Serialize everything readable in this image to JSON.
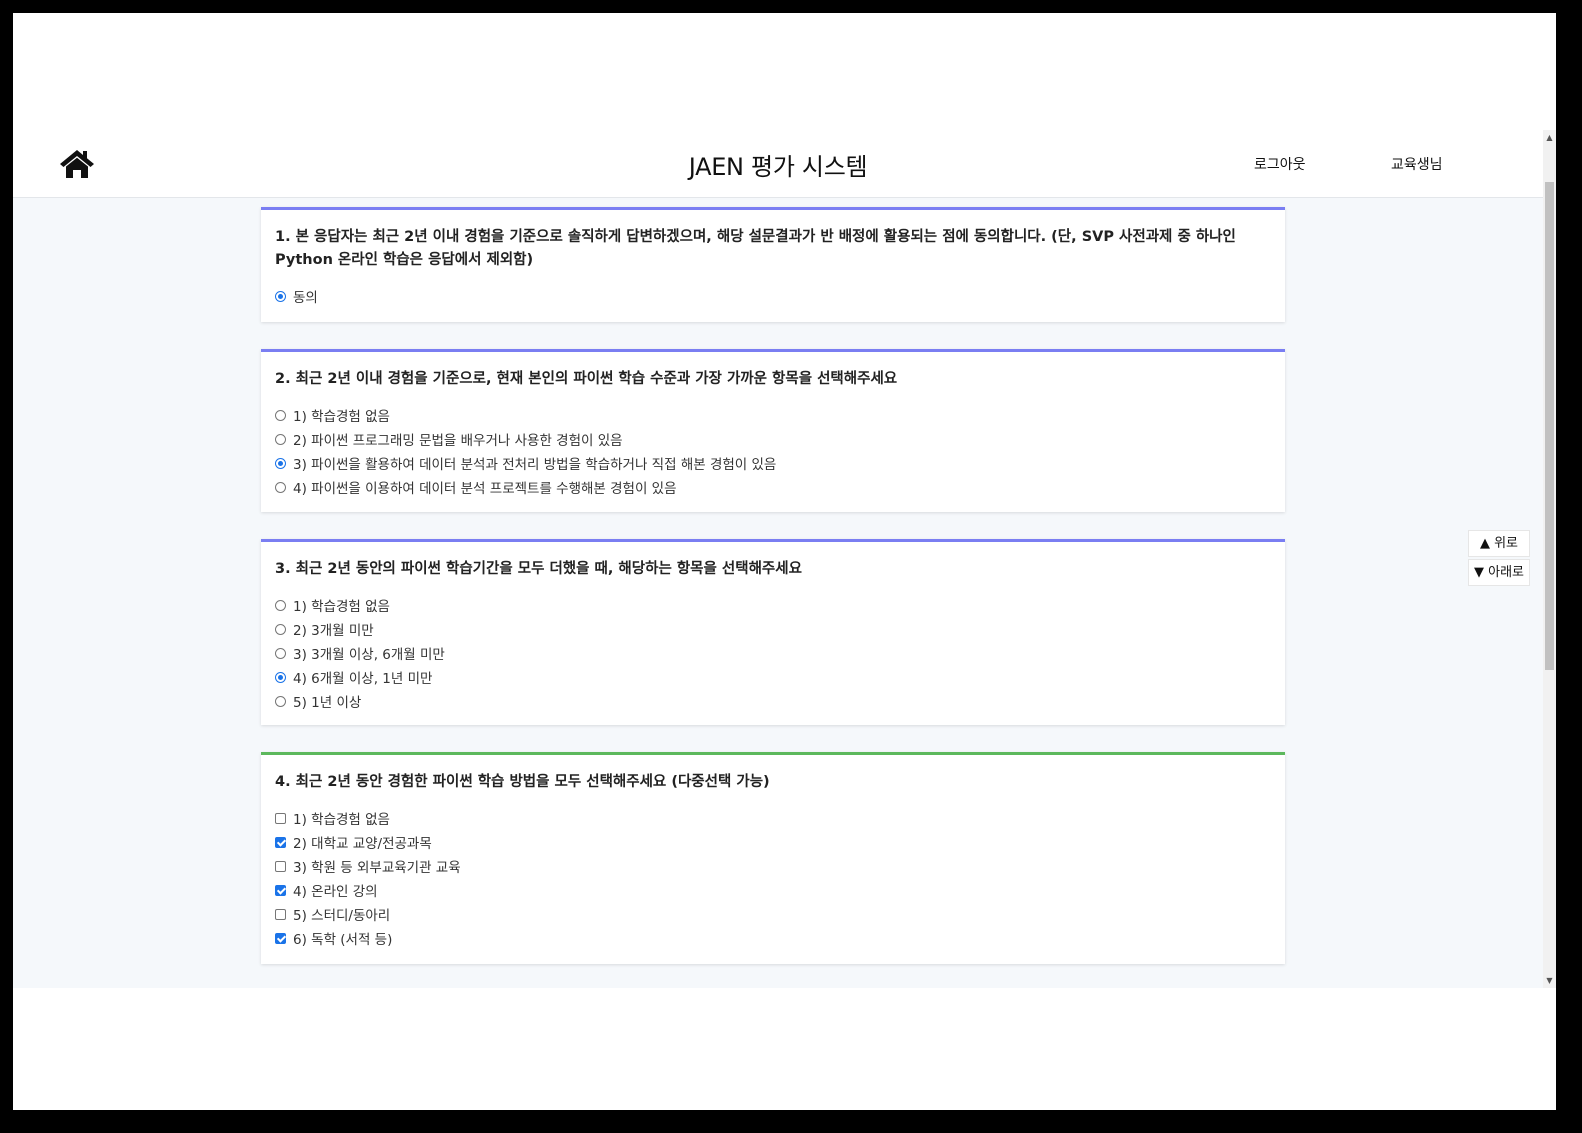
{
  "header": {
    "home_icon": "home-icon",
    "title": "JAEN 평가 시스템",
    "logout_label": "로그아웃",
    "user_label": "교육생님"
  },
  "questions": [
    {
      "title": "1. 본 응답자는 최근 2년 이내 경험을 기준으로 솔직하게 답변하겠으며, 해당 설문결과가 반 배정에 활용되는 점에 동의합니다. (단, SVP 사전과제 중 하나인 Python 온라인 학습은 응답에서 제외함)",
      "type": "radio",
      "options": [
        {
          "label": "동의",
          "checked": true
        }
      ]
    },
    {
      "title": "2. 최근 2년 이내 경험을 기준으로, 현재 본인의 파이썬 학습 수준과 가장 가까운 항목을 선택해주세요",
      "type": "radio",
      "options": [
        {
          "label": "1) 학습경험 없음",
          "checked": false
        },
        {
          "label": "2) 파이썬 프로그래밍 문법을 배우거나 사용한 경험이 있음",
          "checked": false
        },
        {
          "label": "3) 파이썬을 활용하여 데이터 분석과 전처리 방법을 학습하거나 직접 해본 경험이 있음",
          "checked": true
        },
        {
          "label": "4) 파이썬을 이용하여 데이터 분석 프로젝트를 수행해본 경험이 있음",
          "checked": false
        }
      ]
    },
    {
      "title": "3. 최근 2년 동안의 파이썬 학습기간을 모두 더했을 때, 해당하는 항목을 선택해주세요",
      "type": "radio",
      "options": [
        {
          "label": "1) 학습경험 없음",
          "checked": false
        },
        {
          "label": "2) 3개월 미만",
          "checked": false
        },
        {
          "label": "3) 3개월 이상, 6개월 미만",
          "checked": false
        },
        {
          "label": "4) 6개월 이상, 1년 미만",
          "checked": true
        },
        {
          "label": "5) 1년 이상",
          "checked": false
        }
      ]
    },
    {
      "title": "4. 최근 2년 동안 경험한 파이썬 학습 방법을 모두 선택해주세요 (다중선택 가능)",
      "type": "checkbox",
      "options": [
        {
          "label": "1) 학습경험 없음",
          "checked": false
        },
        {
          "label": "2) 대학교 교양/전공과목",
          "checked": true
        },
        {
          "label": "3) 학원 등 외부교육기관 교육",
          "checked": false
        },
        {
          "label": "4) 온라인 강의",
          "checked": true
        },
        {
          "label": "5) 스터디/동아리",
          "checked": false
        },
        {
          "label": "6) 독학 (서적 등)",
          "checked": true
        }
      ]
    }
  ],
  "scroll_nav": {
    "up_label": "▲ 위로",
    "down_label": "▼ 아래로"
  },
  "colors": {
    "radio_card_border": "#7a7ef2",
    "checkbox_card_border": "#5cb85c",
    "accent": "#1a73e8",
    "content_bg": "#f5f8fb"
  }
}
